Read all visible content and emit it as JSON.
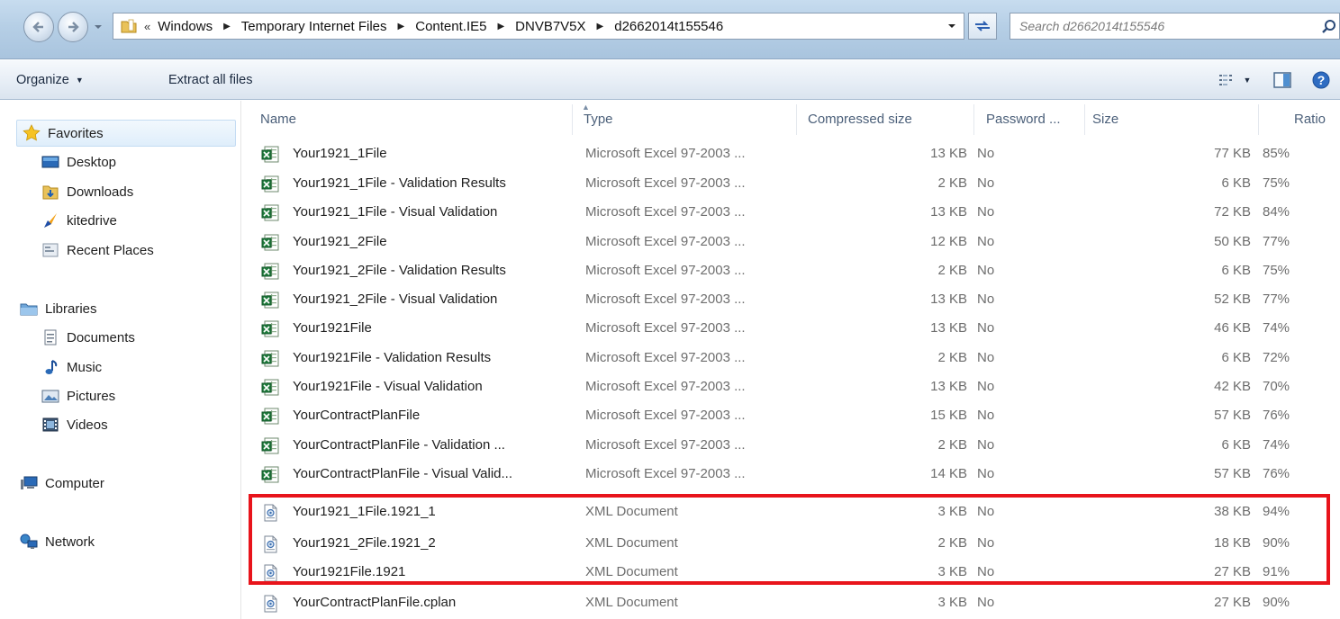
{
  "breadcrumb": {
    "overflow": "«",
    "items": [
      "Windows",
      "Temporary Internet Files",
      "Content.IE5",
      "DNVB7V5X",
      "d2662014t155546"
    ]
  },
  "search": {
    "placeholder": "Search d2662014t155546"
  },
  "toolbar": {
    "organize_label": "Organize",
    "extract_label": "Extract all files"
  },
  "icons": {
    "back": "back-arrow-icon",
    "forward": "forward-arrow-icon",
    "refresh": "refresh-icon",
    "search": "search-icon",
    "view": "view-options-icon",
    "preview": "preview-pane-icon",
    "help": "help-icon"
  },
  "sidebar": {
    "favorites_label": "Favorites",
    "favorites": [
      "Desktop",
      "Downloads",
      "kitedrive",
      "Recent Places"
    ],
    "libraries_label": "Libraries",
    "libraries": [
      "Documents",
      "Music",
      "Pictures",
      "Videos"
    ],
    "computer_label": "Computer",
    "network_label": "Network"
  },
  "columns": {
    "name": "Name",
    "type": "Type",
    "compressed": "Compressed size",
    "password": "Password ...",
    "size": "Size",
    "ratio": "Ratio"
  },
  "files": [
    {
      "name": "Your1921_1File",
      "type": "Microsoft Excel 97-2003 ...",
      "compressed": "13 KB",
      "password": "No",
      "size": "77 KB",
      "ratio": "85%",
      "kind": "excel"
    },
    {
      "name": "Your1921_1File - Validation Results",
      "type": "Microsoft Excel 97-2003 ...",
      "compressed": "2 KB",
      "password": "No",
      "size": "6 KB",
      "ratio": "75%",
      "kind": "excel"
    },
    {
      "name": "Your1921_1File - Visual Validation",
      "type": "Microsoft Excel 97-2003 ...",
      "compressed": "13 KB",
      "password": "No",
      "size": "72 KB",
      "ratio": "84%",
      "kind": "excel"
    },
    {
      "name": "Your1921_2File",
      "type": "Microsoft Excel 97-2003 ...",
      "compressed": "12 KB",
      "password": "No",
      "size": "50 KB",
      "ratio": "77%",
      "kind": "excel"
    },
    {
      "name": "Your1921_2File - Validation Results",
      "type": "Microsoft Excel 97-2003 ...",
      "compressed": "2 KB",
      "password": "No",
      "size": "6 KB",
      "ratio": "75%",
      "kind": "excel"
    },
    {
      "name": "Your1921_2File - Visual Validation",
      "type": "Microsoft Excel 97-2003 ...",
      "compressed": "13 KB",
      "password": "No",
      "size": "52 KB",
      "ratio": "77%",
      "kind": "excel"
    },
    {
      "name": "Your1921File",
      "type": "Microsoft Excel 97-2003 ...",
      "compressed": "13 KB",
      "password": "No",
      "size": "46 KB",
      "ratio": "74%",
      "kind": "excel"
    },
    {
      "name": "Your1921File - Validation Results",
      "type": "Microsoft Excel 97-2003 ...",
      "compressed": "2 KB",
      "password": "No",
      "size": "6 KB",
      "ratio": "72%",
      "kind": "excel"
    },
    {
      "name": "Your1921File - Visual Validation",
      "type": "Microsoft Excel 97-2003 ...",
      "compressed": "13 KB",
      "password": "No",
      "size": "42 KB",
      "ratio": "70%",
      "kind": "excel"
    },
    {
      "name": "YourContractPlanFile",
      "type": "Microsoft Excel 97-2003 ...",
      "compressed": "15 KB",
      "password": "No",
      "size": "57 KB",
      "ratio": "76%",
      "kind": "excel"
    },
    {
      "name": "YourContractPlanFile - Validation ...",
      "type": "Microsoft Excel 97-2003 ...",
      "compressed": "2 KB",
      "password": "No",
      "size": "6 KB",
      "ratio": "74%",
      "kind": "excel"
    },
    {
      "name": "YourContractPlanFile - Visual Valid...",
      "type": "Microsoft Excel 97-2003 ...",
      "compressed": "14 KB",
      "password": "No",
      "size": "57 KB",
      "ratio": "76%",
      "kind": "excel"
    },
    {
      "name": "Your1921_1File.1921_1",
      "type": "XML Document",
      "compressed": "3 KB",
      "password": "No",
      "size": "38 KB",
      "ratio": "94%",
      "kind": "xml"
    },
    {
      "name": "Your1921_2File.1921_2",
      "type": "XML Document",
      "compressed": "2 KB",
      "password": "No",
      "size": "18 KB",
      "ratio": "90%",
      "kind": "xml"
    },
    {
      "name": "Your1921File.1921",
      "type": "XML Document",
      "compressed": "3 KB",
      "password": "No",
      "size": "27 KB",
      "ratio": "91%",
      "kind": "xml"
    },
    {
      "name": "YourContractPlanFile.cplan",
      "type": "XML Document",
      "compressed": "3 KB",
      "password": "No",
      "size": "27 KB",
      "ratio": "90%",
      "kind": "xml"
    }
  ],
  "colors": {
    "highlight_box": "#e8141b",
    "header_text": "#4c607a",
    "excel_green": "#1f7a3c"
  }
}
